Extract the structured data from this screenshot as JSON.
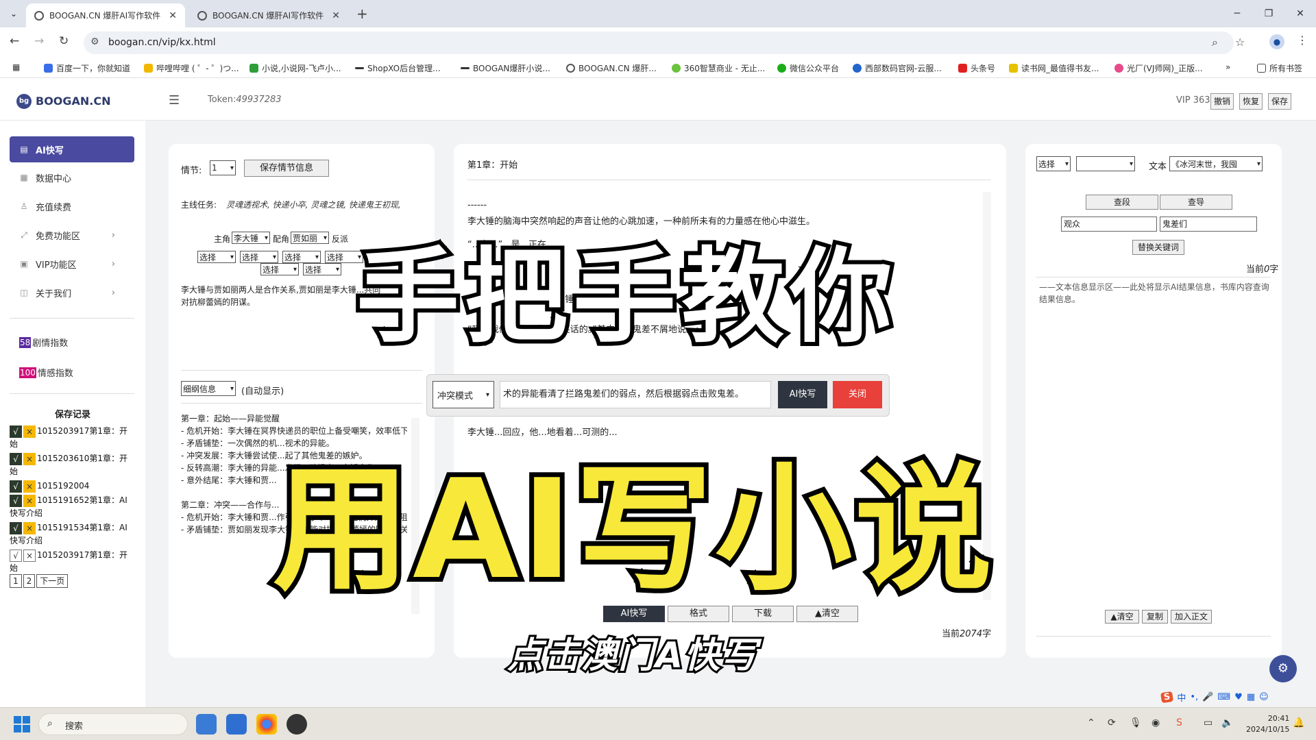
{
  "browser": {
    "tabs": [
      {
        "title": "BOOGAN.CN 爆肝AI写作软件",
        "active": true
      },
      {
        "title": "BOOGAN.CN 爆肝AI写作软件",
        "active": false
      }
    ],
    "url": "boogan.cn/vip/kx.html",
    "bookmarks": [
      "百度一下，你就知道",
      "哔哩哔哩 ( ゜- ゜)つ...",
      "小说,小说网-飞卢小...",
      "ShopXO后台管理...",
      "BOOGAN爆肝小说...",
      "BOOGAN.CN 爆肝...",
      "360智慧商业 - 无止...",
      "微信公众平台",
      "西部数码官网-云服...",
      "头条号",
      "读书网_最值得书友...",
      "光厂(VJ师网)_正版...",
      "所有书签"
    ],
    "accent_color": "#4a4aa0"
  },
  "header": {
    "logo_badge": "bg",
    "logo_text": "BOOGAN.CN",
    "token_label": "Token:",
    "token_value": "49937283",
    "vip": "VIP 363",
    "buttons": [
      "撤销",
      "恢复",
      "保存"
    ]
  },
  "sidebar": {
    "items": [
      {
        "label": "AI快写",
        "icon": "document-icon"
      },
      {
        "label": "数据中心",
        "icon": "table-icon"
      },
      {
        "label": "充值续费",
        "icon": "user-icon"
      },
      {
        "label": "免费功能区",
        "icon": "expand-icon"
      },
      {
        "label": "VIP功能区",
        "icon": "grid-icon"
      },
      {
        "label": "关于我们",
        "icon": "book-icon"
      }
    ],
    "indexes": [
      {
        "badge": "58",
        "label": "剧情指数",
        "color": "#5a2aa0"
      },
      {
        "badge": "100",
        "label": "情感指数",
        "color": "#d0107a"
      }
    ],
    "save_title": "保存记录",
    "records": [
      {
        "check": "√",
        "mark": "×",
        "text": "1015203917第1章：开始"
      },
      {
        "check": "√",
        "mark": "×",
        "text": "1015203610第1章：开始"
      },
      {
        "check": "√",
        "mark": "×",
        "text": "1015192004"
      },
      {
        "check": "√",
        "mark": "×",
        "text": "1015191652第1章：AI快写介绍"
      },
      {
        "check": "√",
        "mark": "×",
        "text": "1015191534第1章：AI快写介绍"
      },
      {
        "check": "√",
        "mark": "×",
        "text": "1015203917第1章：开始"
      }
    ],
    "pager": [
      "1",
      "2",
      "下一页"
    ]
  },
  "left_panel": {
    "plot_label": "情节:",
    "plot_value": "1",
    "save_plot_btn": "保存情节信息",
    "mission_label": "主线任务:",
    "mission_text": "灵魂透视术, 快递小卒, 灵魂之镜, 快递鬼王初现,",
    "protagonist_label": "主角",
    "protagonist_value": "李大锤",
    "support_label": "配角",
    "support_value": "贾如丽",
    "villain_label": "反派",
    "select_placeholder": "选择",
    "relation_text": "李大锤与贾如丽两人是合作关系,贾如丽是李大锤...共同对抗柳蕾嫣的阴谋。",
    "outline_select": "细纲信息",
    "auto_show": "(自动显示)",
    "outline": [
      "第一章：起始——异能觉醒",
      "- 危机开始：李大锤在冥界快递员的职位上备受嘲笑，效率低下，生活困苦。",
      "- 矛盾铺垫：一次偶然的机...视术的异能。",
      "- 冲突发展：李大锤尝试使...起了其他鬼差的嫉妒。",
      "- 反转高潮：李大锤的异能...发现...动提出...大锤合作。",
      "- 意外结尾：李大锤和贾...",
      "",
      "第二章：冲突——合作与...",
      "- 危机开始：李大锤和贾...作引起...小辛...意，他们开始暗中阻挠。",
      "- 矛盾铺垫：贾如丽发现李大锤的异能对揭露柳蕾嫣的阴谋至关重要。"
    ]
  },
  "center_panel": {
    "chapter_title": "第1章：开始",
    "paragraphs": [
      "------",
      "李大锤的脑海中突然响起的声音让他的心跳加速，一种前所未有的力量感在他心中滋生。",
      "“...有...”...是...正在...",
      "...一些...中。",
      "“你...的嘲笑...吗？”李大锤...的鬼...容置疑...",
      "“哼，我们只是来看看你笑话的。”其中一个鬼差不屑地说。",
      "李大锤的话让那些鬼差愣了一下，他们没想到这个看似普通的快递员竟然敢如此回应。",
      "“...看看你有什...”另一...",
      "李大锤...回应，他...地看着...可测的..."
    ],
    "bottom_buttons": [
      "AI快写",
      "格式",
      "下载",
      "▲清空"
    ],
    "count_prefix": "当前",
    "count_value": "2074",
    "count_suffix": "字"
  },
  "popup": {
    "mode": "冲突模式",
    "input_value": "术的异能看清了拦路鬼差们的弱点，然后根据弱点击败鬼差。",
    "ai_btn": "AI快写",
    "close_btn": "关闭"
  },
  "right_panel": {
    "select1": "选择",
    "select2": "",
    "text_label": "文本",
    "text_select": "《冰河末世，我囤",
    "find_para": "查段",
    "find_word": "查导",
    "input1": "观众",
    "input2": "鬼差们",
    "replace_btn": "替换关键词",
    "count_prefix": "当前",
    "count_value": "0",
    "count_suffix": "字",
    "info": "——文本信息显示区——此处将显示AI结果信息，书库内容查询结果信息。",
    "bottom_buttons": [
      "▲清空",
      "复制",
      "加入正文"
    ]
  },
  "overlays": {
    "top": "手把手教你",
    "middle": "用AI写小说",
    "bottom": "点击澳门A快写"
  },
  "taskbar": {
    "search": "搜索",
    "time": "20:41",
    "date": "2024/10/15"
  },
  "ime": "中"
}
